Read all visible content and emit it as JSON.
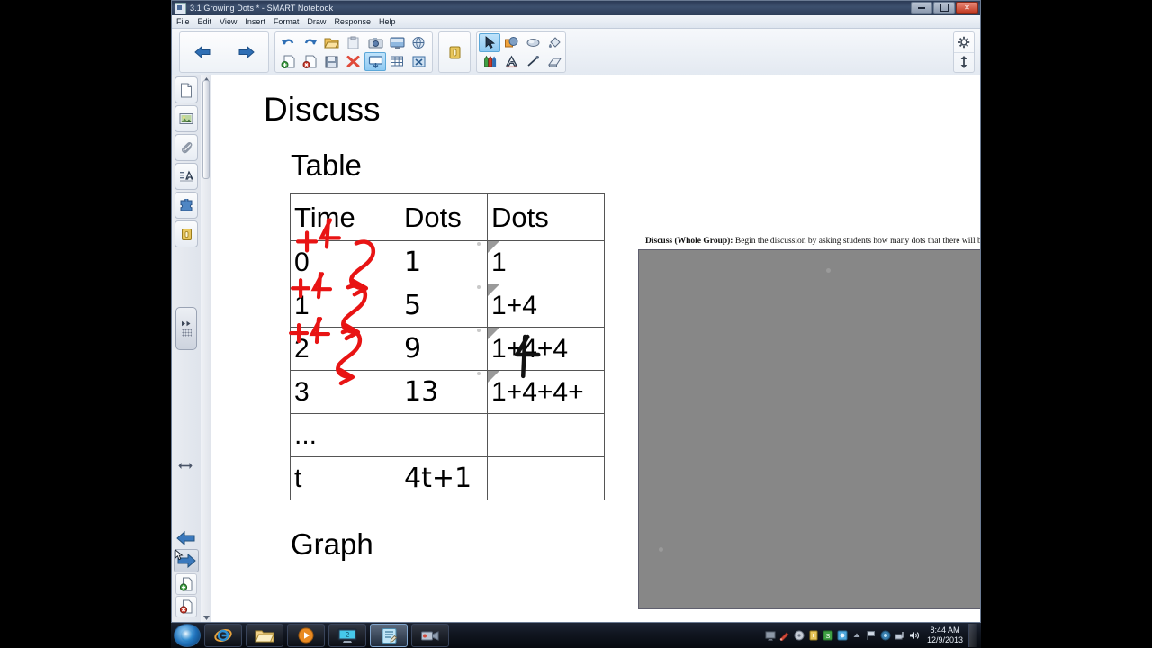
{
  "window": {
    "title": "3.1 Growing Dots * - SMART Notebook",
    "title_icon": "notebook-icon",
    "minimize": "–",
    "maximize": "❐",
    "close": "✕"
  },
  "menu": {
    "items": [
      "File",
      "Edit",
      "View",
      "Insert",
      "Format",
      "Draw",
      "Response",
      "Help"
    ]
  },
  "toolbar": {
    "nav": [
      {
        "name": "previous-page-button",
        "icon": "arrow-left-icon"
      },
      {
        "name": "next-page-button",
        "icon": "arrow-right-icon"
      }
    ],
    "edit_row1": [
      {
        "name": "undo-button",
        "icon": "undo-icon"
      },
      {
        "name": "redo-button",
        "icon": "redo-icon"
      },
      {
        "name": "open-file-button",
        "icon": "folder-icon"
      },
      {
        "name": "paste-button",
        "icon": "clipboard-icon"
      },
      {
        "name": "screen-capture-button",
        "icon": "camera-icon"
      },
      {
        "name": "insert-screen-shade-button",
        "icon": "monitor-icon"
      },
      {
        "name": "insert-internet-browser-button",
        "icon": "globe-icon"
      }
    ],
    "edit_row2": [
      {
        "name": "add-page-button",
        "icon": "page-add-icon"
      },
      {
        "name": "delete-page-button",
        "icon": "page-delete-icon"
      },
      {
        "name": "save-button",
        "icon": "floppy-disk-icon"
      },
      {
        "name": "delete-button",
        "icon": "red-x-icon"
      },
      {
        "name": "full-screen-button",
        "icon": "fullscreen-icon",
        "selected": true
      },
      {
        "name": "insert-table-button",
        "icon": "table-icon"
      },
      {
        "name": "clear-page-button",
        "icon": "clear-page-icon"
      }
    ],
    "lock": {
      "name": "lock-button",
      "icon": "lock-icon"
    },
    "tools_row1": [
      {
        "name": "select-tool",
        "icon": "cursor-arrow-icon",
        "selected": true
      },
      {
        "name": "shapes-tool",
        "icon": "shapes-icon"
      },
      {
        "name": "magic-pen-tool",
        "icon": "magic-pen-icon"
      },
      {
        "name": "fill-tool",
        "icon": "paint-bucket-icon"
      }
    ],
    "tools_row2": [
      {
        "name": "pens-tool",
        "icon": "pens-icon"
      },
      {
        "name": "text-tool",
        "icon": "text-a-icon"
      },
      {
        "name": "line-tool",
        "icon": "line-icon"
      },
      {
        "name": "eraser-tool",
        "icon": "eraser-icon"
      }
    ],
    "right": [
      {
        "name": "toolbar-settings-button",
        "icon": "gear-icon"
      },
      {
        "name": "move-toolbar-button",
        "icon": "up-down-arrow-icon"
      }
    ]
  },
  "sidebar": {
    "tabs": [
      {
        "name": "page-sorter-tab",
        "icon": "page-icon"
      },
      {
        "name": "gallery-tab",
        "icon": "picture-icon"
      },
      {
        "name": "attachments-tab",
        "icon": "paperclip-icon"
      },
      {
        "name": "properties-tab",
        "icon": "properties-icon"
      },
      {
        "name": "add-ons-tab",
        "icon": "puzzle-piece-icon"
      },
      {
        "name": "lesson-activity-tab",
        "icon": "lock-yellow-icon"
      }
    ],
    "handle": {
      "name": "sidebar-collapse-handle",
      "icon": "double-arrow-right-icon"
    },
    "resize": {
      "name": "sidebar-resize-handle",
      "icon": "horizontal-resize-icon"
    },
    "bottom": [
      {
        "name": "previous-page-nav",
        "icon": "arrow-left-blue-icon"
      },
      {
        "name": "next-page-nav",
        "icon": "arrow-right-blue-icon"
      },
      {
        "name": "add-page-small",
        "icon": "page-add-green-icon"
      },
      {
        "name": "delete-page-small",
        "icon": "page-delete-red-icon"
      }
    ]
  },
  "canvas": {
    "title": "Discuss",
    "subtitle_table": "Table",
    "subtitle_graph": "Graph",
    "table": {
      "headers": [
        "Time",
        "Dots",
        "Dots"
      ],
      "rows": [
        {
          "time": "0",
          "dots_num": "1",
          "dots_expr": "1",
          "ink": "+4"
        },
        {
          "time": "1",
          "dots_num": "5",
          "dots_expr": "1+4",
          "ink": "+4"
        },
        {
          "time": "2",
          "dots_num": "9",
          "dots_expr": "1+4+4",
          "ink": "+4"
        },
        {
          "time": "3",
          "dots_num": "13",
          "dots_expr": "1+4+4+",
          "ink": ""
        },
        {
          "time": "...",
          "dots_num": "",
          "dots_expr": "",
          "ink": ""
        },
        {
          "time": "t",
          "dots_num": "4t+1",
          "dots_expr": "",
          "ink": ""
        }
      ],
      "trailing_ink": "4"
    }
  },
  "notes": {
    "label": "Discuss (Whole Group):",
    "body": "Begin the discussion by asking students how many dots that there will be",
    "close": "✕"
  },
  "taskbar": {
    "start": {
      "name": "start-button",
      "icon": "windows-orb-icon"
    },
    "items": [
      {
        "name": "taskbar-internet-explorer",
        "icon": "ie-icon"
      },
      {
        "name": "taskbar-windows-explorer",
        "icon": "folder-icon"
      },
      {
        "name": "taskbar-media-player",
        "icon": "media-player-icon"
      },
      {
        "name": "taskbar-smart-product-drivers",
        "icon": "smart-monitor-icon"
      },
      {
        "name": "taskbar-smart-notebook",
        "icon": "smart-notebook-icon",
        "active": true
      },
      {
        "name": "taskbar-smart-recorder",
        "icon": "recorder-icon"
      }
    ],
    "tray": [
      {
        "name": "tray-smart-board",
        "icon": "smartboard-icon"
      },
      {
        "name": "tray-smart-ink",
        "icon": "ink-pen-icon"
      },
      {
        "name": "tray-disc",
        "icon": "disc-icon"
      },
      {
        "name": "tray-yellow",
        "icon": "yellow-note-icon"
      },
      {
        "name": "tray-green",
        "icon": "green-shield-icon"
      },
      {
        "name": "tray-blue",
        "icon": "blue-square-icon"
      },
      {
        "name": "tray-show-hidden",
        "icon": "chevron-up-icon"
      },
      {
        "name": "tray-action-center",
        "icon": "flag-icon"
      },
      {
        "name": "tray-antivirus",
        "icon": "antivirus-icon"
      },
      {
        "name": "tray-network",
        "icon": "network-icon"
      },
      {
        "name": "tray-volume",
        "icon": "speaker-icon"
      }
    ],
    "clock_time": "8:44 AM",
    "clock_date": "12/9/2013",
    "show_desktop": {
      "name": "show-desktop-button"
    }
  },
  "colors": {
    "ink_red": "#e81414",
    "accent_blue": "#2f6fb5",
    "panel_gray": "#878787"
  }
}
